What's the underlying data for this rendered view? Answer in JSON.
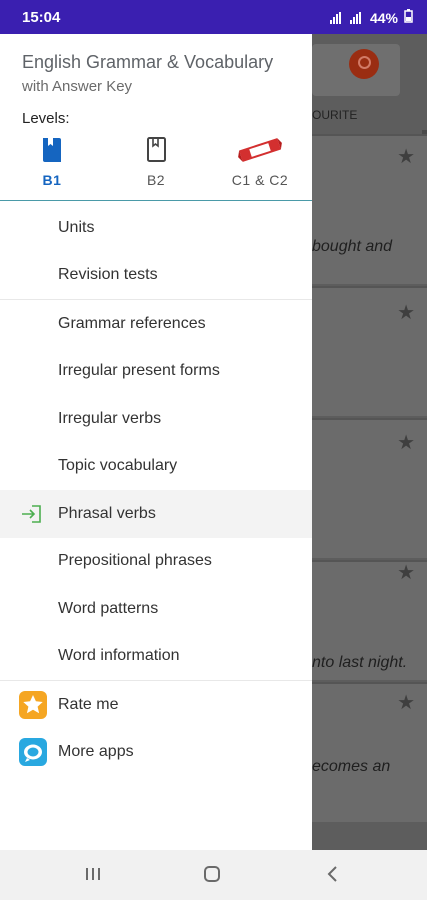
{
  "status": {
    "time": "15:04",
    "battery": "44%"
  },
  "background": {
    "tab_fragment": "OURITE",
    "snippets": [
      "bought and",
      "nto last night.",
      "ecomes an"
    ]
  },
  "drawer": {
    "title": "English Grammar & Vocabulary",
    "subtitle": "with Answer Key",
    "levels_label": "Levels:",
    "levels": [
      {
        "label": "B1",
        "icon": "book-filled-icon",
        "active": true
      },
      {
        "label": "B2",
        "icon": "book-outline-icon",
        "active": false
      },
      {
        "label": "C1 & C2",
        "icon": "ribbon-badge-icon",
        "active": false
      }
    ],
    "menu": [
      {
        "label": "Units"
      },
      {
        "label": "Revision tests"
      },
      {
        "label": "Grammar references"
      },
      {
        "label": "Irregular present forms"
      },
      {
        "label": "Irregular verbs"
      },
      {
        "label": "Topic vocabulary"
      },
      {
        "label": "Phrasal verbs",
        "icon": "enter-arrow-icon",
        "selected": true
      },
      {
        "label": "Prepositional phrases"
      },
      {
        "label": "Word patterns"
      },
      {
        "label": "Word information"
      }
    ],
    "extra": [
      {
        "label": "Rate me",
        "icon": "star-badge-icon"
      },
      {
        "label": "More apps",
        "icon": "apps-bubble-icon"
      }
    ]
  },
  "colors": {
    "accent": "#1565c0",
    "statusbar": "#3a1fb0",
    "divider": "#4a9aa8"
  }
}
